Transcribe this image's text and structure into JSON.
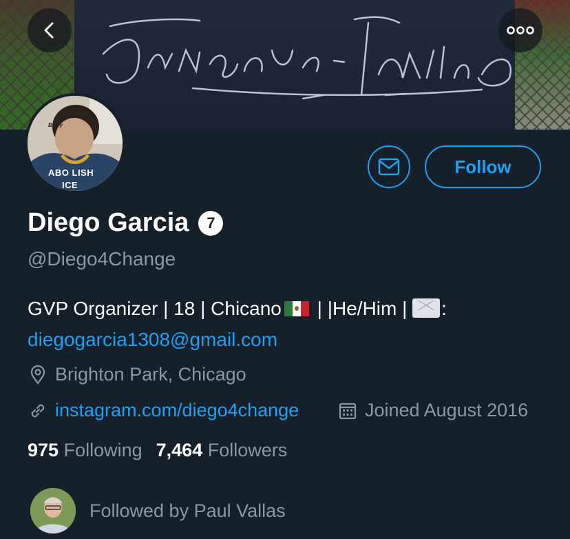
{
  "header": {
    "back_icon": "chevron-left-icon",
    "more_icon": "more-horizontal-icon",
    "banner_text": "Danger Dus Familias"
  },
  "avatar": {
    "labels": [
      "ABO LISH",
      "ICE",
      "Baby"
    ]
  },
  "actions": {
    "message_icon": "envelope-icon",
    "follow_label": "Follow"
  },
  "profile": {
    "name": "Diego Garcia",
    "badge": "7",
    "handle": "@Diego4Change",
    "bio_text": "GVP Organizer | 18 | Chicano",
    "bio_mid": " | |He/Him | ",
    "bio_after": ":",
    "email": "diegogarcia1308@gmail.com",
    "location": "Brighton Park, Chicago",
    "website": "instagram.com/diego4change",
    "joined": "Joined August 2016"
  },
  "stats": {
    "following_count": "975",
    "following_label": "Following",
    "followers_count": "7,464",
    "followers_label": "Followers"
  },
  "followed_by": {
    "text": "Followed by Paul Vallas"
  },
  "colors": {
    "background": "#15202b",
    "accent": "#1da1f2",
    "secondary_text": "#8899a6"
  }
}
